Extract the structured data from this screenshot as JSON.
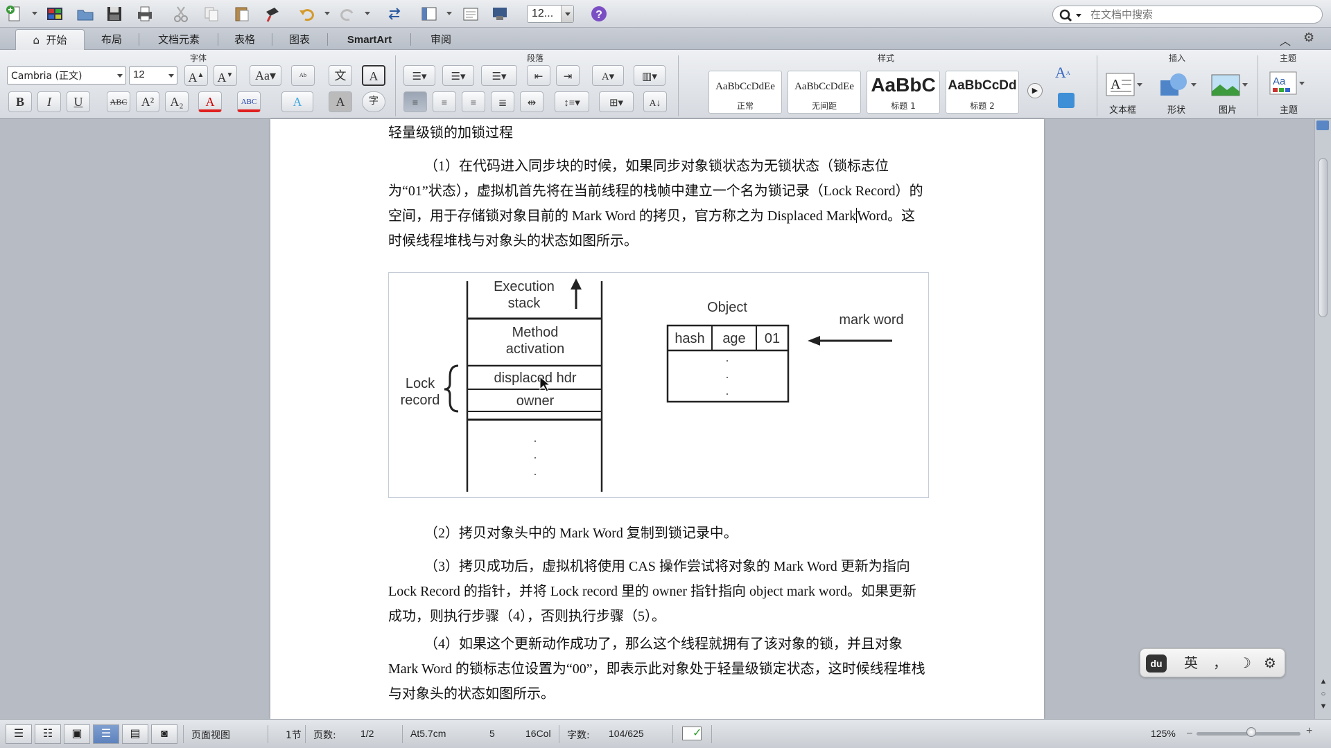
{
  "toolbar": {
    "zoom_value": "12...",
    "search_placeholder": "在文档中搜索"
  },
  "tabs": [
    {
      "label": "开始",
      "active": true
    },
    {
      "label": "布局"
    },
    {
      "label": "文档元素"
    },
    {
      "label": "表格"
    },
    {
      "label": "图表"
    },
    {
      "label": "SmartArt"
    },
    {
      "label": "审阅"
    }
  ],
  "ribbon": {
    "font_group": "字体",
    "paragraph_group": "段落",
    "styles_group": "样式",
    "insert_group": "插入",
    "theme_group": "主题",
    "font_name": "Cambria (正文)",
    "font_size": "12",
    "styles": [
      {
        "sample": "AaBbCcDdEe",
        "name": "正常"
      },
      {
        "sample": "AaBbCcDdEe",
        "name": "无间距"
      },
      {
        "sample": "AaBbC",
        "name": "标题 1"
      },
      {
        "sample": "AaBbCcDd",
        "name": "标题 2"
      }
    ],
    "insert_items": {
      "textbox": "文本框",
      "shape": "形状",
      "picture": "图片"
    },
    "theme_label": "主题",
    "buttons": {
      "bold": "B",
      "italic": "I",
      "underline": "U",
      "strike": "ABC",
      "superscript": "A²",
      "subscript": "A₂",
      "font_color": "A",
      "highlight": "ABC",
      "text_effects": "A",
      "char_shading": "A",
      "enclose": "字"
    }
  },
  "document": {
    "heading": "轻量级锁的加锁过程",
    "p1": "（1）在代码进入同步块的时候，如果同步对象锁状态为无锁状态（锁标志位为“01”状态），虚拟机首先将在当前线程的栈帧中建立一个名为锁记录（Lock Record）的空间，用于存储锁对象目前的 Mark Word 的拷贝，官方称之为 Displaced Mark",
    "p1_tail": "Word。这时候线程堆栈与对象头的状态如图所示。",
    "p2": "（2）拷贝对象头中的 Mark Word 复制到锁记录中。",
    "p3": "（3）拷贝成功后，虚拟机将使用 CAS 操作尝试将对象的 Mark Word 更新为指向 Lock Record 的指针，并将 Lock record 里的 owner 指针指向 object mark word。如果更新成功，则执行步骤（4），否则执行步骤（5）。",
    "p4": "（4）如果这个更新动作成功了，那么这个线程就拥有了该对象的锁，并且对象 Mark Word 的锁标志位设置为“00”，即表示此对象处于轻量级锁定状态，这时候线程堆栈与对象头的状态如图所示。"
  },
  "figure": {
    "exec_stack_1": "Execution",
    "exec_stack_2": "stack",
    "method_1": "Method",
    "method_2": "activation",
    "displaced": "displaced hdr",
    "owner": "owner",
    "lock_1": "Lock",
    "lock_2": "record",
    "object": "Object",
    "hash": "hash",
    "age": "age",
    "bits": "01",
    "mark_word": "mark word"
  },
  "ime": {
    "lang": "英",
    "punct": "，",
    "moon": "☽",
    "gear": "⚙"
  },
  "status": {
    "view_name": "页面视图",
    "section": "1节",
    "pages_label": "页数:",
    "pages_value": "1/2",
    "at": "At5.7cm",
    "line": "5",
    "col": "16Col",
    "words_label": "字数:",
    "words_value": "104/625",
    "zoom": "125%"
  },
  "colors": {
    "accent": "#5e82bd",
    "font_color_bar": "#e02020"
  }
}
